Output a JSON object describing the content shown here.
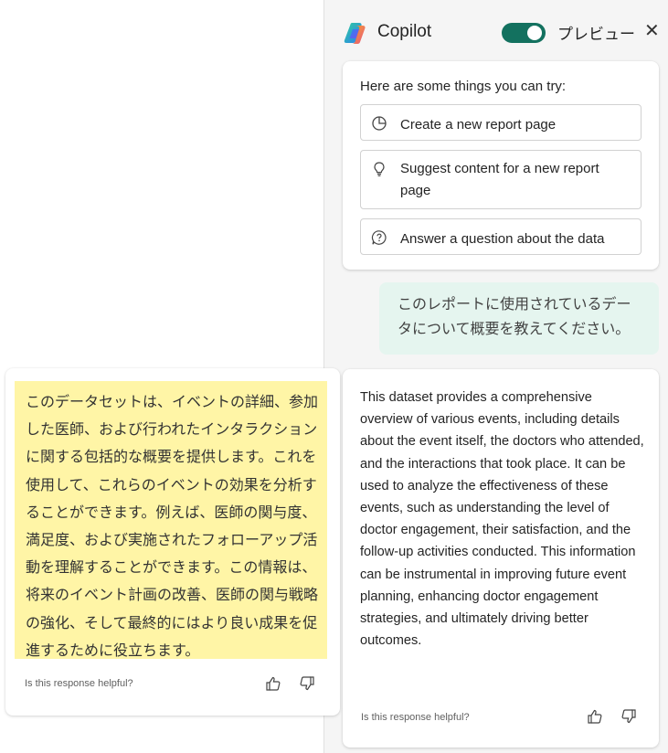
{
  "copilot": {
    "title": "Copilot",
    "preview_label": "プレビュー",
    "close_glyph": "✕",
    "toggle_on": true,
    "accent_color": "#13715f"
  },
  "suggestions": {
    "heading": "Here are some things you can try:",
    "items": [
      {
        "label": "Create a new report page",
        "icon": "pie-chart-icon"
      },
      {
        "label": "Suggest content for a new report page",
        "icon": "lightbulb-icon"
      },
      {
        "label": "Answer a question about the data",
        "icon": "question-bubble-icon"
      }
    ]
  },
  "user_message": "このレポートに使用されているデータについて概要を教えてください。",
  "response": {
    "text": "This dataset provides a comprehensive overview of various events, including details about the event itself, the doctors who attended, and the interactions that took place. It can be used to analyze the effectiveness of these events, such as understanding the level of doctor engagement, their satisfaction, and the follow-up activities conducted. This information can be instrumental in improving future event planning, enhancing doctor engagement strategies, and ultimately driving better outcomes.",
    "feedback_prompt": "Is this response helpful?"
  },
  "translation": {
    "text": "このデータセットは、イベントの詳細、参加した医師、および行われたインタラクションに関する包括的な概要を提供します。これを使用して、これらのイベントの効果を分析することができます。例えば、医師の関与度、満足度、および実施されたフォローアップ活動を理解することができます。この情報は、将来のイベント計画の改善、医師の関与戦略の強化、そして最終的にはより良い成果を促進するために役立ちます。",
    "feedback_prompt": "Is this response helpful?",
    "highlight_color": "#fff5a6"
  }
}
